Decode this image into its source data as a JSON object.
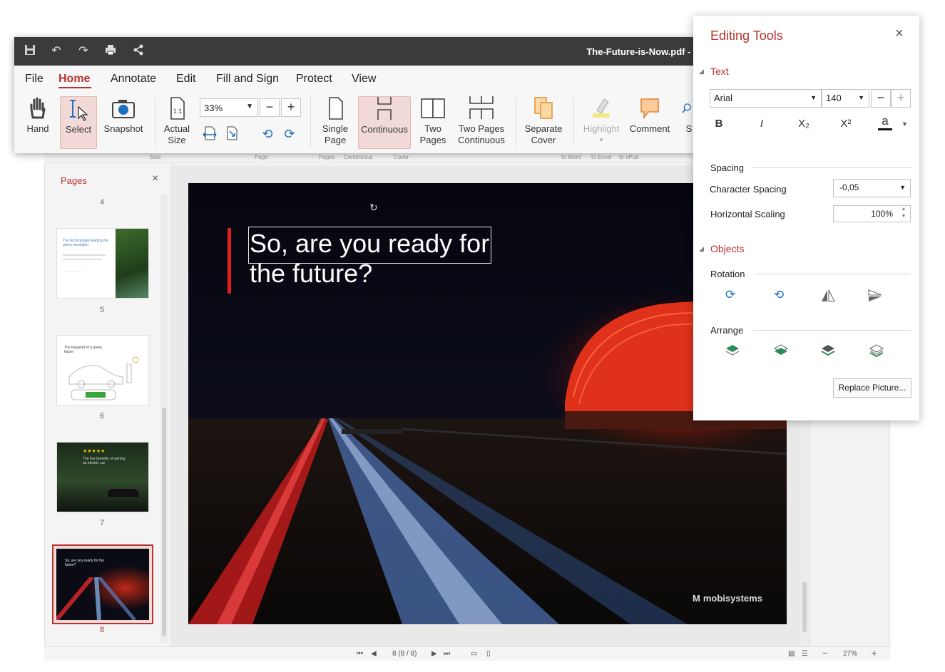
{
  "window": {
    "doc_title": "The-Future-is-Now.pdf - F"
  },
  "menu": {
    "items": [
      "File",
      "Home",
      "Annotate",
      "Edit",
      "Fill and Sign",
      "Protect",
      "View"
    ],
    "active": "Home"
  },
  "toolbar": {
    "hand": "Hand",
    "select": "Select",
    "snapshot": "Snapshot",
    "actual_size_1": "Actual",
    "actual_size_2": "Size",
    "actual_size_badge": "1:1",
    "zoom_value": "33%",
    "zoom_minus": "−",
    "zoom_plus": "+",
    "single_page_1": "Single",
    "single_page_2": "Page",
    "continuous": "Continuous",
    "two_pages_1": "Two",
    "two_pages_2": "Pages",
    "two_pages_cont_1": "Two Pages",
    "two_pages_cont_2": "Continuous",
    "separate_cover_1": "Separate",
    "separate_cover_2": "Cover",
    "highlight": "Highlight",
    "comment": "Comment",
    "partial": "S"
  },
  "ghost_ribbon": {
    "size": "Size",
    "page": "Page",
    "pages": "Pages",
    "continuous": "Continuous",
    "cover": "Cover",
    "to_word": "to Word",
    "to_excel": "to Excel",
    "to_epub": "to ePub"
  },
  "pages_panel": {
    "title": "Pages",
    "close": "×",
    "thumbnails": [
      {
        "num": "4"
      },
      {
        "num": "5",
        "caption": "The technologies leading the green revolution"
      },
      {
        "num": "6",
        "caption": "The blueprint of a green future"
      },
      {
        "num": "7",
        "caption": "The five benefits of owning an electric car",
        "stars": "★★★★★"
      },
      {
        "num": "8",
        "caption": "So, are you ready for the future?"
      }
    ]
  },
  "slide": {
    "headline_line1": "So, are you ready for",
    "headline_line2": "the future?",
    "brand": "mobisystems"
  },
  "statusbar": {
    "page_indicator": "8 (8 / 8)",
    "zoom": "27%",
    "minus": "−",
    "plus": "+"
  },
  "editing_tools": {
    "title": "Editing Tools",
    "close": "×",
    "text_section": "Text",
    "font": "Arial",
    "size": "140",
    "size_minus": "−",
    "size_plus": "+",
    "bold": "B",
    "italic": "I",
    "subscript": "X₂",
    "superscript": "X²",
    "color_letter": "a",
    "spacing_label": "Spacing",
    "char_spacing_label": "Character Spacing",
    "char_spacing_value": "-0,05",
    "horiz_scaling_label": "Horizontal Scaling",
    "horiz_scaling_value": "100%",
    "objects_section": "Objects",
    "rotation_label": "Rotation",
    "arrange_label": "Arrange",
    "replace_picture": "Replace Picture..."
  },
  "colors": {
    "accent": "#b8322e",
    "titlebar": "#3b3b3b",
    "icon_blue": "#1e6fc0",
    "arrange_green": "#2e8b57"
  }
}
